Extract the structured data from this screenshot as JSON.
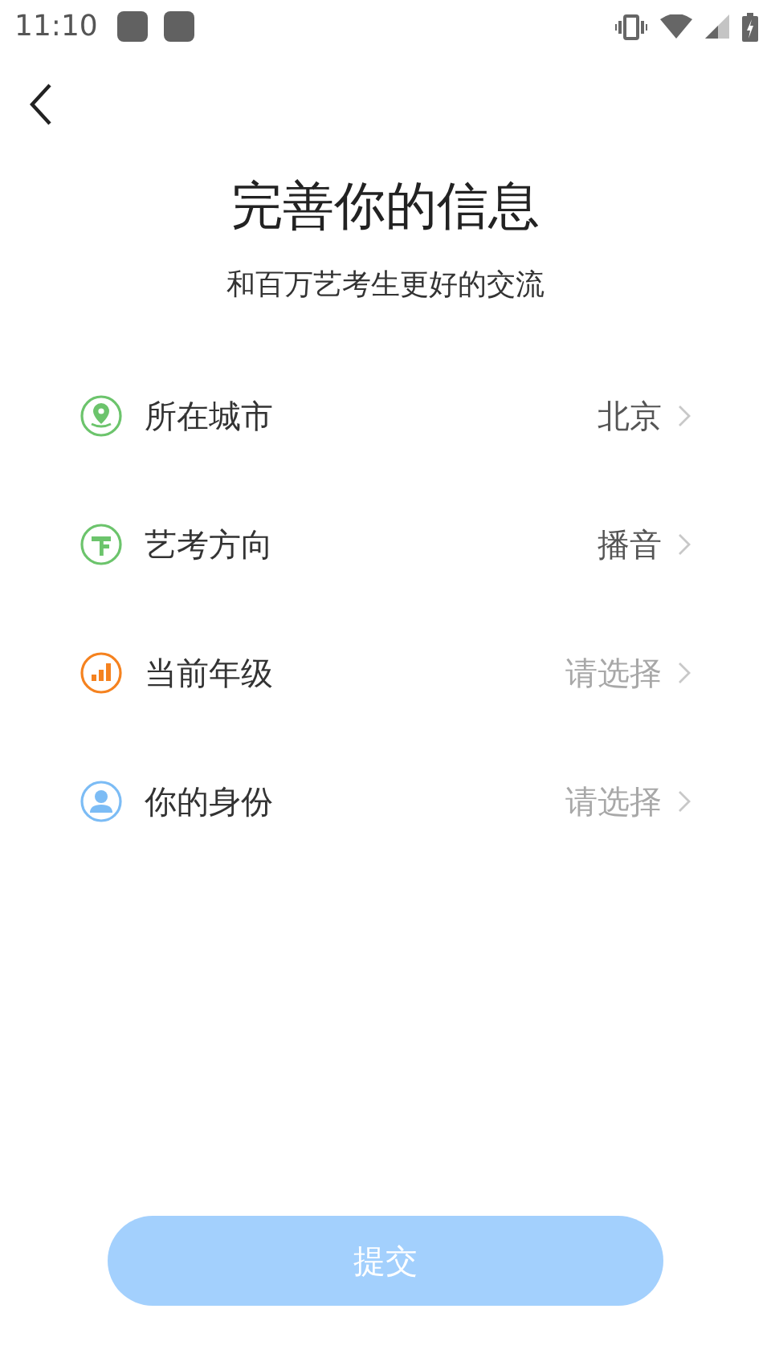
{
  "status_bar": {
    "time": "11:10"
  },
  "title": "完善你的信息",
  "subtitle": "和百万艺考生更好的交流",
  "rows": [
    {
      "kind": "location",
      "color": "#6cc46c",
      "label": "所在城市",
      "value": "北京"
    },
    {
      "kind": "signpost",
      "color": "#6cc46c",
      "label": "艺考方向",
      "value": "播音"
    },
    {
      "kind": "bars",
      "color": "#f5821f",
      "label": "当前年级",
      "placeholder": "请选择"
    },
    {
      "kind": "person",
      "color": "#7cbcf5",
      "label": "你的身份",
      "placeholder": "请选择"
    }
  ],
  "submit": {
    "label": "提交",
    "disabled": true
  }
}
